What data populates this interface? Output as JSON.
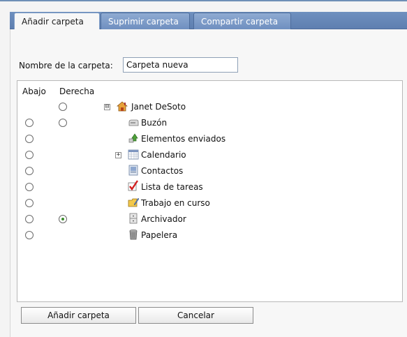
{
  "tabs": [
    {
      "label": "Añadir carpeta",
      "active": true
    },
    {
      "label": "Suprimir carpeta",
      "active": false
    },
    {
      "label": "Compartir carpeta",
      "active": false
    }
  ],
  "form": {
    "name_label": "Nombre de la carpeta:",
    "name_value": "Carpeta nueva"
  },
  "tree": {
    "col_abajo": "Abajo",
    "col_derecha": "Derecha",
    "root": {
      "label": "Janet DeSoto",
      "icon": "home-icon",
      "expander": "⊟"
    },
    "items": [
      {
        "label": "Buzón",
        "icon": "mailbox-icon"
      },
      {
        "label": "Elementos enviados",
        "icon": "sent-items-icon"
      },
      {
        "label": "Calendario",
        "icon": "calendar-icon",
        "expander": "+"
      },
      {
        "label": "Contactos",
        "icon": "contacts-icon"
      },
      {
        "label": "Lista de tareas",
        "icon": "checklist-icon"
      },
      {
        "label": "Trabajo en curso",
        "icon": "work-in-progress-icon"
      },
      {
        "label": "Archivador",
        "icon": "cabinet-icon"
      },
      {
        "label": "Papelera",
        "icon": "trash-icon"
      }
    ],
    "selected_derecha": "Archivador"
  },
  "buttons": {
    "add_label": "Añadir carpeta",
    "cancel_label": "Cancelar"
  },
  "colors": {
    "tab_bar": "#6f90bf",
    "radio_selected": "#3a8c2c"
  }
}
